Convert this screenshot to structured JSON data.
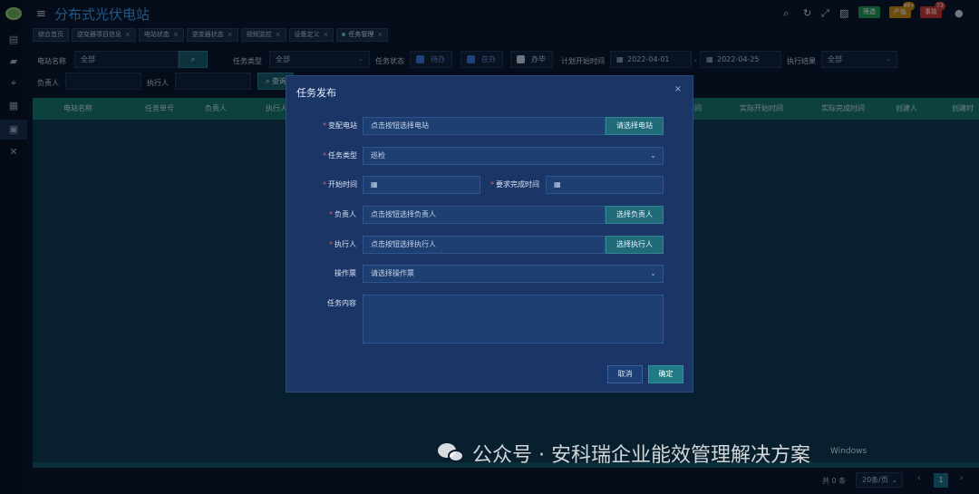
{
  "app": {
    "title": "分布式光伏电站"
  },
  "header_badges": [
    {
      "label": "筛选",
      "color": "#1f9a5a"
    },
    {
      "label": "产值",
      "color": "#c98a16",
      "count": "99+"
    },
    {
      "label": "事故",
      "color": "#c83838",
      "count": "73"
    }
  ],
  "tabs": [
    {
      "label": "综合首页",
      "closable": false
    },
    {
      "label": "逆变器项目信息",
      "closable": true
    },
    {
      "label": "电站状态",
      "closable": true
    },
    {
      "label": "逆变器状态",
      "closable": true
    },
    {
      "label": "视频监控",
      "closable": true
    },
    {
      "label": "设备定义",
      "closable": true
    },
    {
      "label": "任务管理",
      "closable": true,
      "active": true
    }
  ],
  "tab_close": "×",
  "filters": {
    "station_label": "电站名称",
    "station_value": "全部",
    "task_type_label": "任务类型",
    "task_type_value": "全部",
    "task_status_label": "任务状态",
    "status_options": [
      {
        "label": "待办",
        "checked": true
      },
      {
        "label": "在办",
        "checked": true
      },
      {
        "label": "办毕",
        "checked": false
      }
    ],
    "plan_start_label": "计划开始时间",
    "date_from": "2022-04-01",
    "date_sep": "-",
    "date_to": "2022-04-25",
    "result_label": "执行结果",
    "result_value": "全部",
    "owner_label": "负责人",
    "executor_label": "执行人",
    "search_label": "查询"
  },
  "table": {
    "columns": [
      "电站名称",
      "任务单号",
      "负责人",
      "执行人",
      "计划开始时间",
      "实际开始时间",
      "实际完成时间",
      "创建人",
      "创建时"
    ]
  },
  "pagination": {
    "total": "共 0 条",
    "page_size": "20条/页",
    "current": "1",
    "prev": "‹",
    "next": "›"
  },
  "modal": {
    "title": "任务发布",
    "close": "×",
    "fields": {
      "station": {
        "label": "变配电站",
        "placeholder": "点击按钮选择电站",
        "button": "请选择电站"
      },
      "task_type": {
        "label": "任务类型",
        "value": "巡检"
      },
      "start_time": {
        "label": "开始时间"
      },
      "due_time": {
        "label": "要求完成时间"
      },
      "owner": {
        "label": "负责人",
        "placeholder": "点击按钮选择负责人",
        "button": "选择负责人"
      },
      "executor": {
        "label": "执行人",
        "placeholder": "点击按钮选择执行人",
        "button": "选择执行人"
      },
      "ticket": {
        "label": "操作票",
        "placeholder": "请选择操作票"
      },
      "content": {
        "label": "任务内容"
      }
    },
    "cancel": "取消",
    "confirm": "确定"
  },
  "watermark": {
    "text": "公众号 · 安科瑞企业能效管理解决方案",
    "small": "Windows"
  }
}
